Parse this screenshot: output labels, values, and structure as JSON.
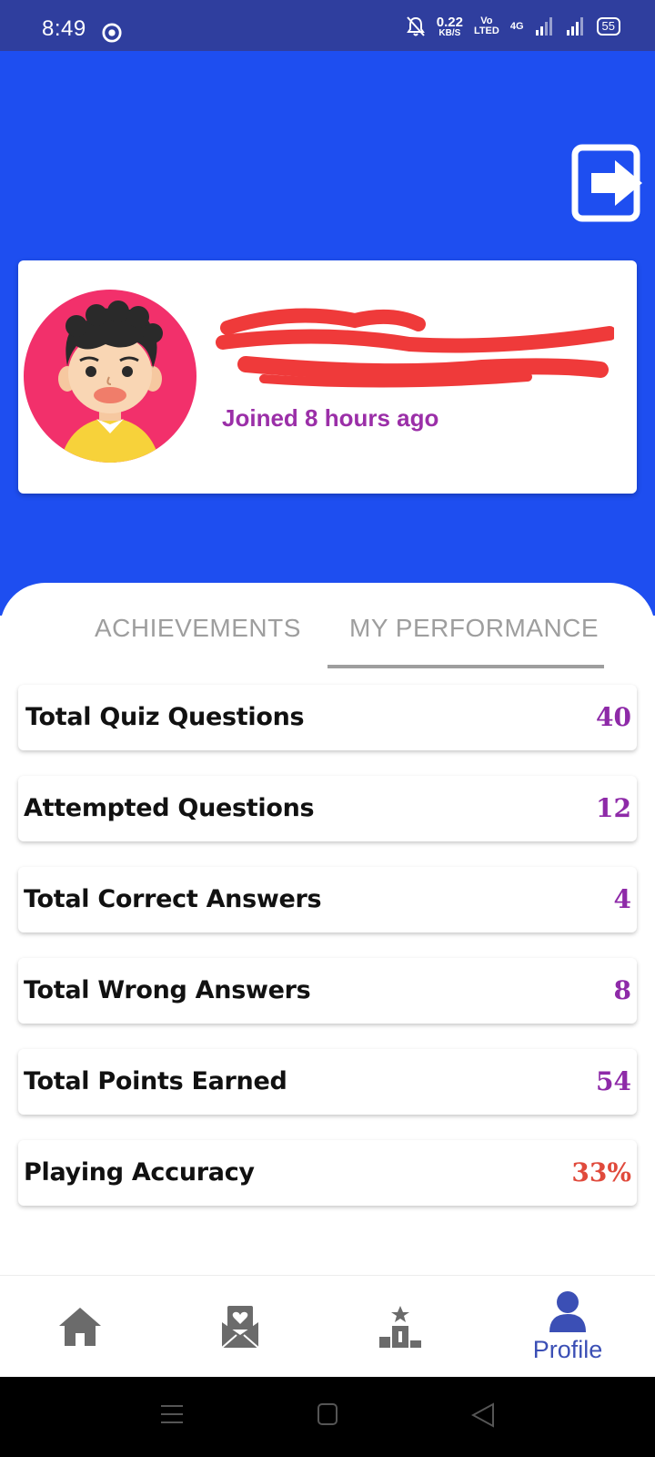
{
  "status_bar": {
    "time": "8:49",
    "net_speed_value": "0.22",
    "net_speed_unit": "KB/S",
    "volte_top": "Vo",
    "volte_bottom": "LTED",
    "network": "4G",
    "battery": "55"
  },
  "profile": {
    "joined": "Joined 8 hours ago"
  },
  "tabs": [
    {
      "label": "ACHIEVEMENTS",
      "active": false
    },
    {
      "label": "MY PERFORMANCE",
      "active": true
    }
  ],
  "stats": [
    {
      "label": "Total Quiz Questions",
      "value": "40"
    },
    {
      "label": "Attempted Questions",
      "value": "12"
    },
    {
      "label": "Total Correct Answers",
      "value": "4"
    },
    {
      "label": "Total Wrong Answers",
      "value": "8"
    },
    {
      "label": "Total Points Earned",
      "value": "54"
    },
    {
      "label": "Playing Accuracy",
      "value": "33%"
    }
  ],
  "bottom_nav": {
    "items": [
      {
        "icon": "home-icon"
      },
      {
        "icon": "favorite-mail-icon"
      },
      {
        "icon": "leaderboard-icon"
      },
      {
        "icon": "profile-icon",
        "label": "Profile"
      }
    ]
  },
  "colors": {
    "status_bar": "#2f3e9e",
    "hero": "#1e4ef0",
    "accent_purple": "#9b2fa8",
    "accuracy_red": "#e04a3c",
    "nav_active": "#3b4fb5"
  }
}
